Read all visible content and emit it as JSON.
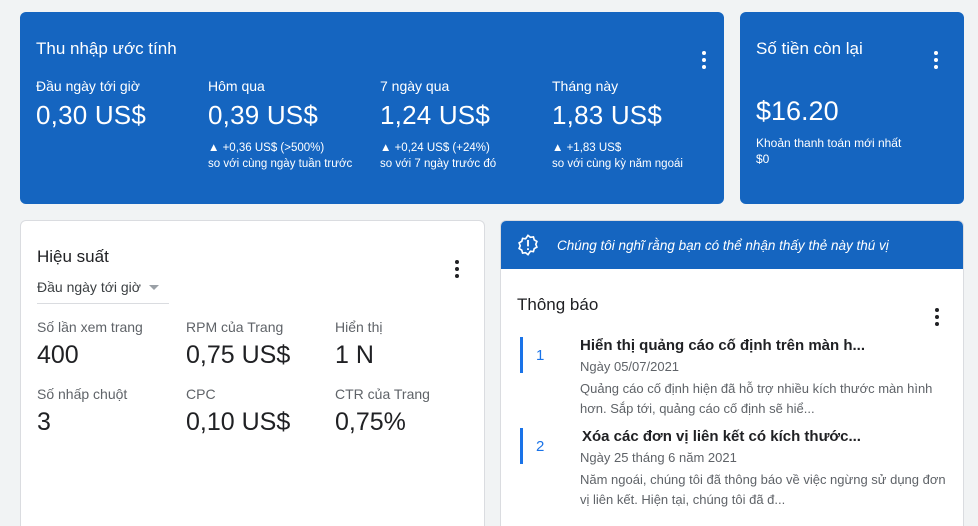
{
  "earnings": {
    "title": "Thu nhập ước tính",
    "metrics": [
      {
        "label": "Đầu ngày tới giờ",
        "value": "0,30 US$",
        "change": "",
        "compare": ""
      },
      {
        "label": "Hôm qua",
        "value": "0,39 US$",
        "change": "▲ +0,36 US$ (>500%)",
        "compare": "so với cùng ngày tuần trước"
      },
      {
        "label": "7 ngày qua",
        "value": "1,24 US$",
        "change": "▲ +0,24 US$ (+24%)",
        "compare": "so với 7 ngày trước đó"
      },
      {
        "label": "Tháng này",
        "value": "1,83 US$",
        "change": "▲ +1,83 US$",
        "compare": "so với cùng kỳ năm ngoái"
      }
    ]
  },
  "balance": {
    "title": "Số tiền còn lại",
    "amount": "$16.20",
    "last_payment_label": "Khoản thanh toán mới nhất",
    "last_payment_value": "$0"
  },
  "performance": {
    "title": "Hiệu suất",
    "range": "Đầu ngày tới giờ",
    "metrics": [
      {
        "label": "Số lần xem trang",
        "value": "400"
      },
      {
        "label": "RPM của Trang",
        "value": "0,75 US$"
      },
      {
        "label": "Hiển thị",
        "value": "1 N"
      },
      {
        "label": "Số nhấp chuột",
        "value": "3"
      },
      {
        "label": "CPC",
        "value": "0,10 US$"
      },
      {
        "label": "CTR của Trang",
        "value": "0,75%"
      }
    ]
  },
  "notifications": {
    "banner": "Chúng tôi nghĩ rằng bạn có thể nhận thấy thẻ này thú vị",
    "title": "Thông báo",
    "items": [
      {
        "num": "1",
        "title": "Hiển thị quảng cáo cố định trên màn h...",
        "date": "Ngày 05/07/2021",
        "body": "Quảng cáo cố định hiện đã hỗ trợ nhiều kích thước màn hình hơn. Sắp tới, quảng cáo cố định sẽ hiể..."
      },
      {
        "num": "2",
        "title": "Xóa các đơn vị liên kết có kích thước...",
        "date": "Ngày 25 tháng 6 năm 2021",
        "body": "Năm ngoái, chúng tôi đã thông báo về việc ngừng sử dụng đơn vị liên kết. Hiện tại, chúng tôi đã đ..."
      }
    ]
  },
  "icons": {
    "menu": "more-vert-icon",
    "banner": "badge-icon",
    "dropdown": "caret-down-icon"
  },
  "colors": {
    "primary": "#1565c0",
    "link": "#1a73e8",
    "background": "#f1f3f4"
  }
}
